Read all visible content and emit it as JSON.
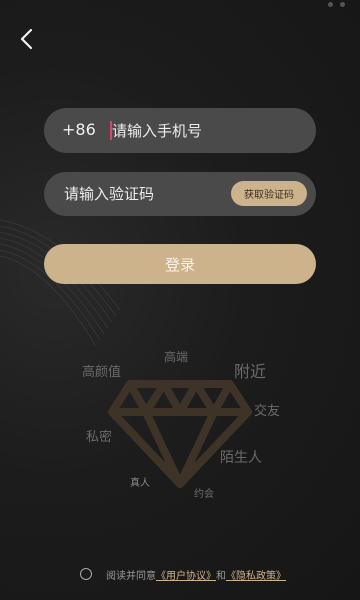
{
  "colors": {
    "accent": "#cdb38c",
    "field_bg": "#4a4a4a",
    "background": "#1b1b1b",
    "caret": "#e0406a"
  },
  "nav": {
    "back_icon": "chevron-left-icon"
  },
  "login_form": {
    "country_code": "+86",
    "phone_placeholder": "请输入手机号",
    "code_placeholder": "请输入验证码",
    "get_code_label": "获取验证码",
    "submit_label": "登录"
  },
  "background_tags": [
    "高颜值",
    "高端",
    "附近",
    "交友",
    "私密",
    "陌生人",
    "真人",
    "约会"
  ],
  "decoration_icon": "diamond-icon",
  "agreement": {
    "prefix": "阅读并同意",
    "user_agreement": "《用户协议》",
    "connector": "和",
    "privacy_policy": "《隐私政策》"
  }
}
